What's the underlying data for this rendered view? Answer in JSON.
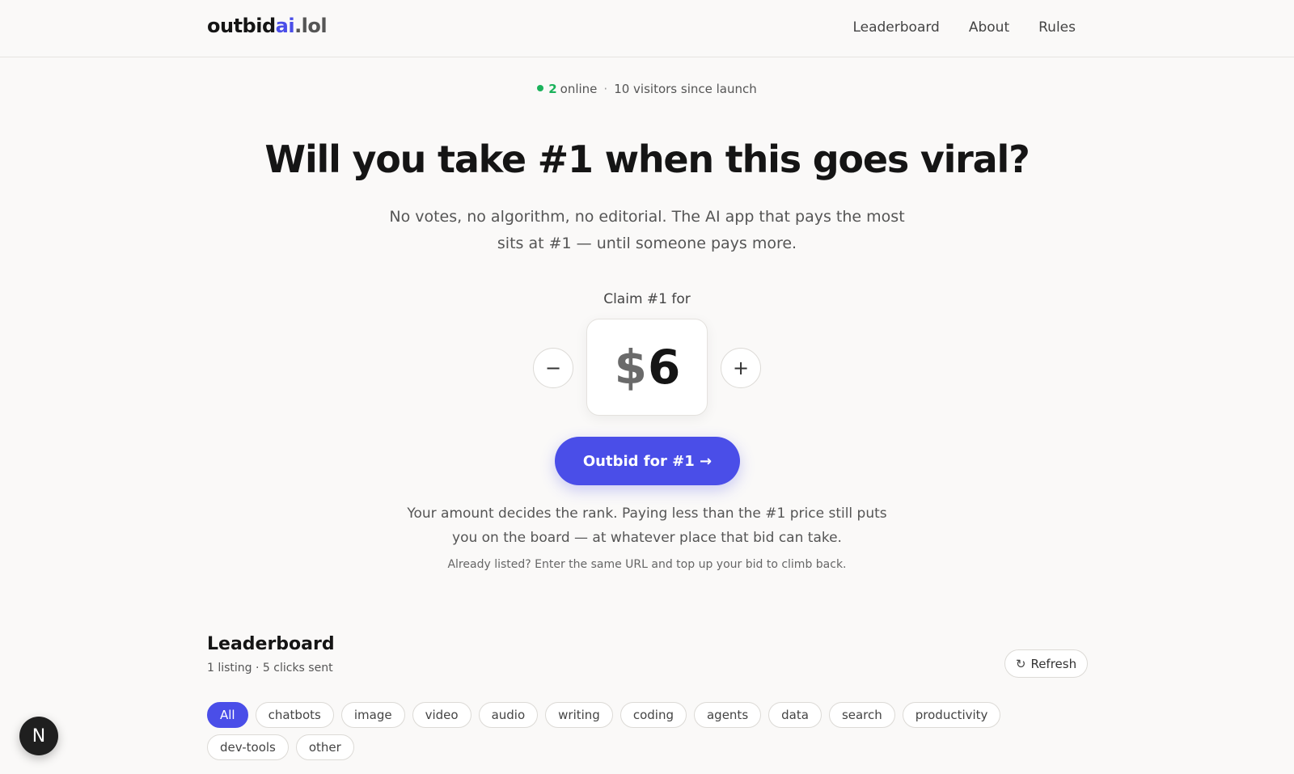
{
  "header": {
    "logo_main": "outbid",
    "logo_ai": "ai",
    "logo_tld": ".lol",
    "nav": [
      {
        "label": "Leaderboard"
      },
      {
        "label": "About"
      },
      {
        "label": "Rules"
      }
    ]
  },
  "presence": {
    "online_count": "2",
    "online_label": "online",
    "separator": "·",
    "visitors": "10 visitors since launch"
  },
  "hero": {
    "headline": "Will you take #1 when this goes viral?",
    "subline": "No votes, no algorithm, no editorial. The AI app that pays the most sits at #1 — until someone pays more."
  },
  "bid": {
    "claim_label": "Claim #1 for",
    "minus_symbol": "−",
    "plus_symbol": "+",
    "currency": "$",
    "amount": "6",
    "cta_label": "Outbid for #1 →",
    "note": "Your amount decides the rank. Paying less than the #1 price still puts you on the board — at whatever place that bid can take.",
    "note_small": "Already listed? Enter the same URL and top up your bid to climb back."
  },
  "leaderboard": {
    "title": "Leaderboard",
    "meta": "1 listing · 5 clicks sent",
    "refresh_icon": "↻",
    "refresh_label": "Refresh",
    "categories": [
      {
        "label": "All",
        "active": true
      },
      {
        "label": "chatbots"
      },
      {
        "label": "image"
      },
      {
        "label": "video"
      },
      {
        "label": "audio"
      },
      {
        "label": "writing"
      },
      {
        "label": "coding"
      },
      {
        "label": "agents"
      },
      {
        "label": "data"
      },
      {
        "label": "search"
      },
      {
        "label": "productivity"
      },
      {
        "label": "dev-tools"
      },
      {
        "label": "other"
      }
    ]
  },
  "fab": {
    "letter": "N"
  },
  "colors": {
    "accent": "#4a4ee8",
    "online_dot": "#1bb25b",
    "background": "#faf9f8"
  }
}
